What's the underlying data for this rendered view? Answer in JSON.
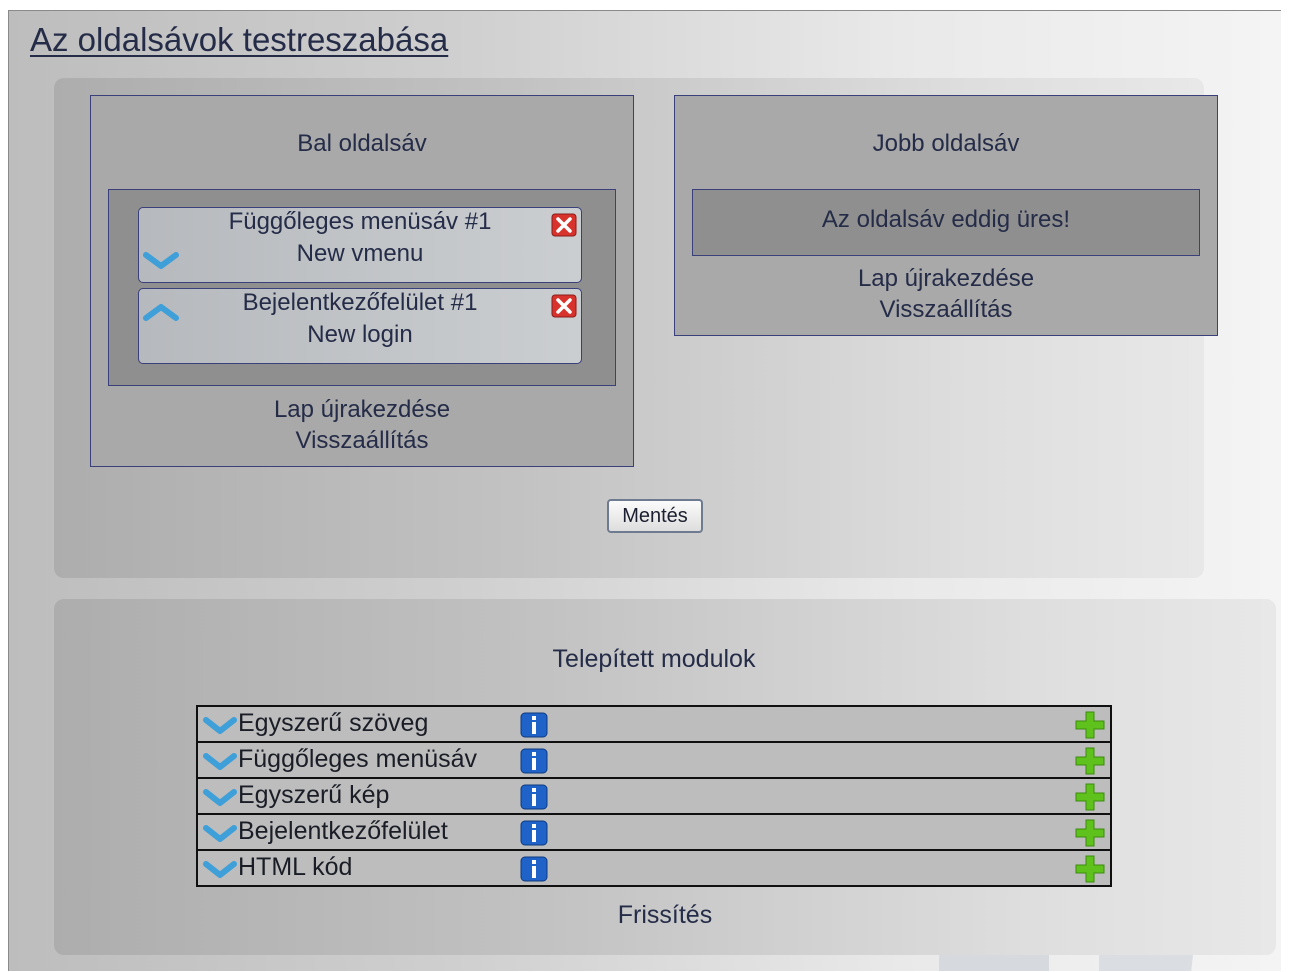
{
  "page": {
    "title": "Az oldalsávok testreszabása"
  },
  "left_sidebar": {
    "heading": "Bal oldalsáv",
    "modules": [
      {
        "title": "Függőleges menüsáv #1",
        "subtitle": "New vmenu",
        "arrow_icon": "chevron-down-icon",
        "delete_icon": "close-icon"
      },
      {
        "title": "Bejelentkezőfelület #1",
        "subtitle": "New login",
        "arrow_icon": "chevron-up-icon",
        "delete_icon": "close-icon"
      }
    ],
    "reset_label": "Lap újrakezdése",
    "restore_label": "Visszaállítás"
  },
  "right_sidebar": {
    "heading": "Jobb oldalsáv",
    "empty_message": "Az oldalsáv eddig üres!",
    "reset_label": "Lap újrakezdése",
    "restore_label": "Visszaállítás"
  },
  "save_button": {
    "label": "Mentés"
  },
  "installed": {
    "heading": "Telepített modulok",
    "rows": [
      {
        "name": "Egyszerű szöveg"
      },
      {
        "name": "Függőleges menüsáv"
      },
      {
        "name": "Egyszerű kép"
      },
      {
        "name": "Bejelentkezőfelület"
      },
      {
        "name": "HTML kód"
      }
    ],
    "row_icons": {
      "expand": "chevron-down-icon",
      "info": "info-icon",
      "add": "plus-icon"
    },
    "refresh_label": "Frissítés"
  },
  "colors": {
    "text": "#252c48",
    "border": "#39407a",
    "delete_red": "#d8322c",
    "info_blue": "#1f63c9",
    "add_green": "#5fc21c",
    "arrow_blue": "#3f9fd9"
  }
}
